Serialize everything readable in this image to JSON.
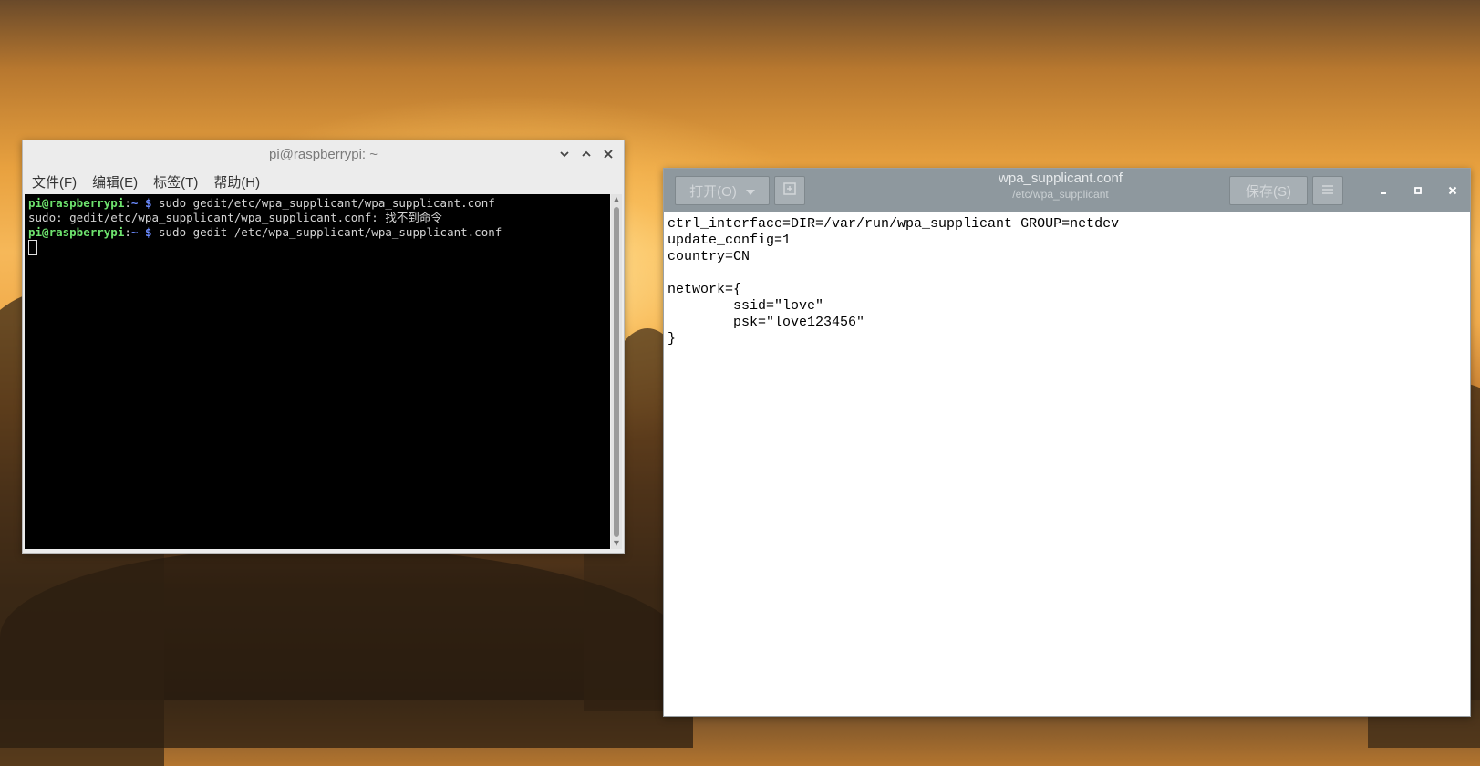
{
  "terminal": {
    "title": "pi@raspberrypi: ~",
    "menu": [
      "文件(F)",
      "编辑(E)",
      "标签(T)",
      "帮助(H)"
    ],
    "lines": [
      {
        "prompt_user": "pi@raspberrypi",
        "prompt_sep": ":",
        "prompt_path": "~ $",
        "text": " sudo gedit/etc/wpa_supplicant/wpa_supplicant.conf"
      },
      {
        "text": "sudo: gedit/etc/wpa_supplicant/wpa_supplicant.conf: 找不到命令"
      },
      {
        "prompt_user": "pi@raspberrypi",
        "prompt_sep": ":",
        "prompt_path": "~ $",
        "text": " sudo gedit /etc/wpa_supplicant/wpa_supplicant.conf"
      }
    ]
  },
  "gedit": {
    "open_label": "打开(O)",
    "save_label": "保存(S)",
    "title": "wpa_supplicant.conf",
    "subtitle": "/etc/wpa_supplicant",
    "content_lines": [
      "ctrl_interface=DIR=/var/run/wpa_supplicant GROUP=netdev",
      "update_config=1",
      "country=CN",
      "",
      "network={",
      "        ssid=\"love\"",
      "        psk=\"love123456\"",
      "}"
    ]
  },
  "icons": {
    "term_minimize": "chevron-down-icon",
    "term_maximize": "chevron-up-icon",
    "term_close": "close-icon",
    "gedit_dropdown": "caret-down-icon",
    "gedit_new_tab": "new-tab-icon",
    "gedit_menu": "hamburger-icon",
    "gedit_minimize": "minimize-icon",
    "gedit_maximize": "maximize-icon",
    "gedit_close": "close-icon"
  }
}
